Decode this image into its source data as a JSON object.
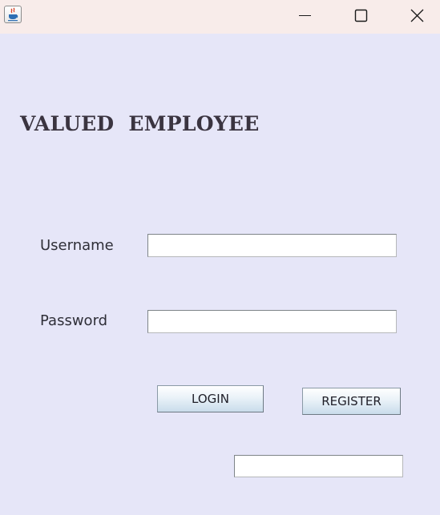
{
  "window": {
    "icon": "java-cup-icon",
    "controls": {
      "minimize": "minimize-icon",
      "maximize": "maximize-icon",
      "close": "close-icon"
    }
  },
  "form": {
    "heading": "VALUED  EMPLOYEE",
    "username_label": "Username",
    "username_value": "",
    "password_label": "Password",
    "password_value": "",
    "login_label": "LOGIN",
    "register_label": "REGISTER",
    "status_value": ""
  },
  "colors": {
    "background": "#e6e6f8",
    "titlebar": "#f8ecea",
    "heading_text": "#3a3440"
  }
}
